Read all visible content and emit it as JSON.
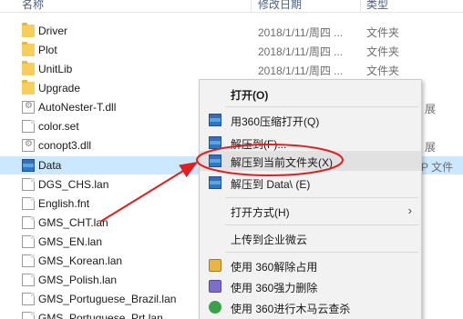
{
  "header": {
    "name_col": "名称",
    "date_col": "修改日期",
    "type_col": "类型"
  },
  "files": [
    {
      "name": "Driver",
      "date": "2018/1/11/周四 ...",
      "type": "文件夹",
      "icon": "folder-icon"
    },
    {
      "name": "Plot",
      "date": "2018/1/11/周四 ...",
      "type": "文件夹",
      "icon": "folder-icon"
    },
    {
      "name": "UnitLib",
      "date": "2018/1/11/周四 ...",
      "type": "文件夹",
      "icon": "folder-icon"
    },
    {
      "name": "Upgrade",
      "icon": "folder-icon"
    },
    {
      "name": "AutoNester-T.dll",
      "type_right": "展",
      "icon": "settings-file-icon"
    },
    {
      "name": "color.set",
      "icon": "file-icon"
    },
    {
      "name": "conopt3.dll",
      "type_right": "展",
      "icon": "settings-file-icon"
    },
    {
      "name": "Data",
      "type_right": "P 文件",
      "icon": "archive-icon",
      "selected": true
    },
    {
      "name": "DGS_CHS.lan",
      "icon": "file-icon"
    },
    {
      "name": "English.fnt",
      "icon": "file-icon"
    },
    {
      "name": "GMS_CHT.lan",
      "icon": "file-icon"
    },
    {
      "name": "GMS_EN.lan",
      "icon": "file-icon"
    },
    {
      "name": "GMS_Korean.lan",
      "icon": "file-icon"
    },
    {
      "name": "GMS_Polish.lan",
      "icon": "file-icon"
    },
    {
      "name": "GMS_Portuguese_Brazil.lan",
      "icon": "file-icon"
    },
    {
      "name": "GMS_Portuguese_Prt.lan",
      "icon": "file-icon"
    }
  ],
  "menu": {
    "open": "打开(O)",
    "open_360": "用360压缩打开(Q)",
    "extract_to": "解压到(F)...",
    "extract_here": "解压到当前文件夹(X)",
    "extract_data": "解压到 Data\\ (E)",
    "open_with": "打开方式(H)",
    "upload": "上传到企业微云",
    "unlock_360": "使用 360解除占用",
    "force_delete_360": "使用 360强力删除",
    "trojan_scan_360": "使用 360进行木马云查杀"
  },
  "colors": {
    "selection": "#cce8ff",
    "annotation": "#e02020"
  }
}
